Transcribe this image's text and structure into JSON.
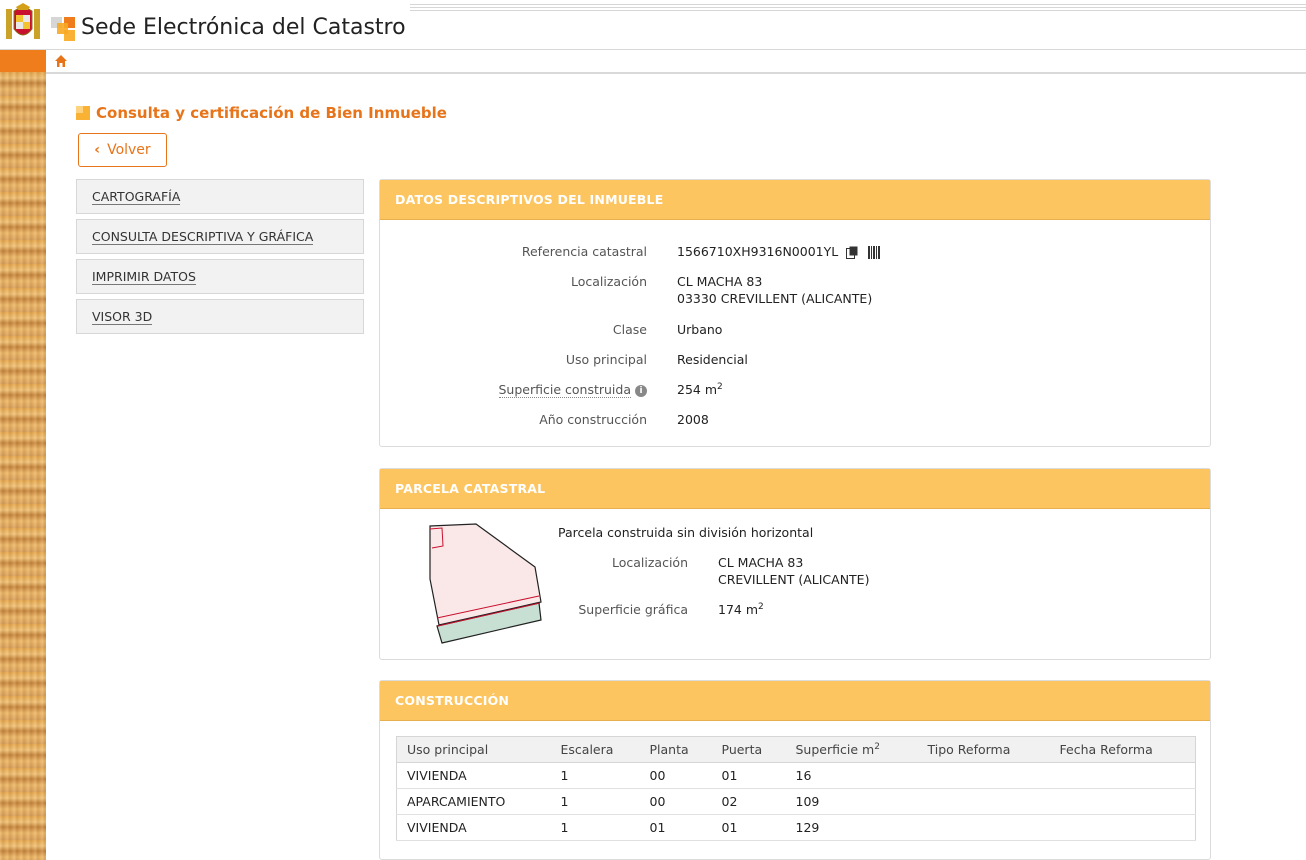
{
  "header": {
    "site_title": "Sede Electrónica del Catastro"
  },
  "page": {
    "heading": "Consulta y certificación de Bien Inmueble",
    "back_label": "Volver"
  },
  "menu": {
    "items": [
      {
        "label": "CARTOGRAFÍA"
      },
      {
        "label": "CONSULTA DESCRIPTIVA Y GRÁFICA"
      },
      {
        "label": "IMPRIMIR DATOS"
      },
      {
        "label": "VISOR 3D"
      }
    ]
  },
  "datos": {
    "title": "DATOS DESCRIPTIVOS DEL INMUEBLE",
    "ref_label": "Referencia catastral",
    "ref_value": "1566710XH9316N0001YL",
    "loc_label": "Localización",
    "loc_line1": "CL MACHA 83",
    "loc_line2": "03330 CREVILLENT (ALICANTE)",
    "clase_label": "Clase",
    "clase_value": "Urbano",
    "uso_label": "Uso principal",
    "uso_value": "Residencial",
    "sup_label": "Superficie construida",
    "sup_value": "254 m",
    "sup_exp": "2",
    "anio_label": "Año construcción",
    "anio_value": "2008"
  },
  "parcela": {
    "title": "PARCELA CATASTRAL",
    "subtitle": "Parcela construida sin división horizontal",
    "loc_label": "Localización",
    "loc_line1": "CL MACHA 83",
    "loc_line2": "CREVILLENT (ALICANTE)",
    "sup_label": "Superficie gráfica",
    "sup_value": "174 m",
    "sup_exp": "2"
  },
  "construccion": {
    "title": "CONSTRUCCIÓN",
    "headers": [
      "Uso principal",
      "Escalera",
      "Planta",
      "Puerta",
      "Superficie m",
      "Tipo Reforma",
      "Fecha Reforma"
    ],
    "sup_header_exp": "2",
    "rows": [
      [
        "VIVIENDA",
        "1",
        "00",
        "01",
        "16",
        "",
        ""
      ],
      [
        "APARCAMIENTO",
        "1",
        "00",
        "02",
        "109",
        "",
        ""
      ],
      [
        "VIVIENDA",
        "1",
        "01",
        "01",
        "129",
        "",
        ""
      ]
    ]
  },
  "colors": {
    "accent": "#e8741a",
    "panel_header": "#fdc55f",
    "breadcrumb_orange": "#ef7d1c"
  }
}
